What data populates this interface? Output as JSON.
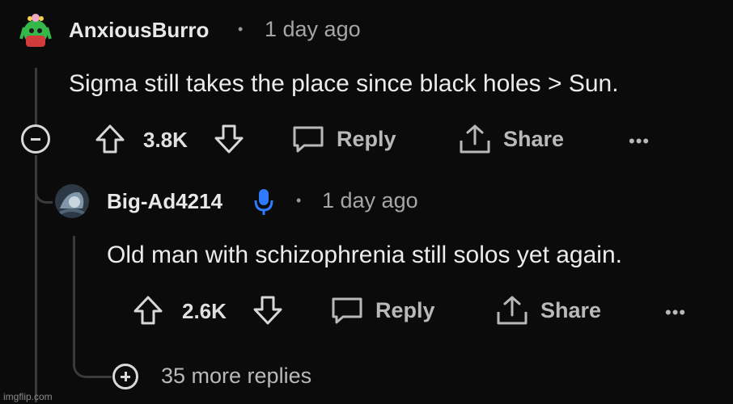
{
  "comments": [
    {
      "username": "AnxiousBurro",
      "separator": "•",
      "time": "1 day ago",
      "text": "Sigma still takes the place since black holes > Sun.",
      "votes": "3.8K",
      "reply_label": "Reply",
      "share_label": "Share",
      "more_label": "•••"
    },
    {
      "username": "Big-Ad4214",
      "separator": "•",
      "time": "1 day ago",
      "text": "Old man with schizophrenia still solos yet again.",
      "votes": "2.6K",
      "reply_label": "Reply",
      "share_label": "Share",
      "more_label": "•••"
    }
  ],
  "more_replies": "35 more replies",
  "watermark": "imgflip.com",
  "colors": {
    "background": "#0b0b0b",
    "text": "#ececec",
    "muted": "#a6a6a6",
    "mic": "#2f7bff"
  }
}
